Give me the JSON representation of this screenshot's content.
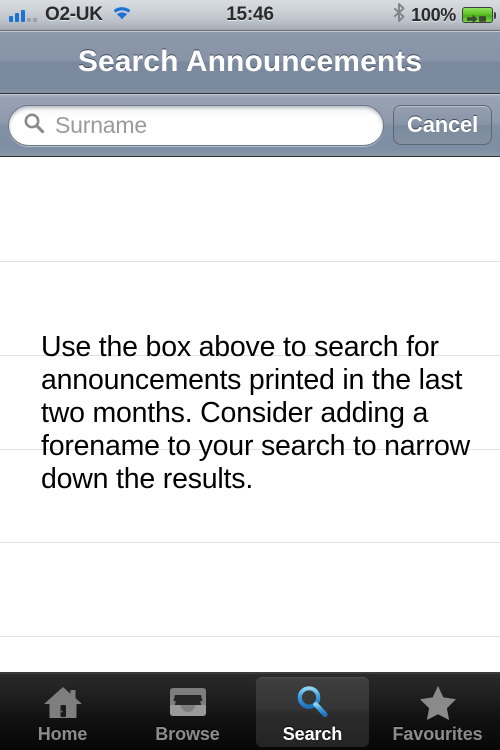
{
  "status_bar": {
    "signal_icon": "signal-bars-icon",
    "signal_bars_filled": 3,
    "signal_bars_empty": 2,
    "carrier": "O2-UK",
    "wifi_icon": "wifi-icon",
    "time": "15:46",
    "bluetooth_icon": "bluetooth-icon",
    "battery_percent": "100%",
    "battery_icon": "battery-charging-icon",
    "battery_color": "#5cc423"
  },
  "nav_bar": {
    "title": "Search Announcements"
  },
  "search_bar": {
    "search_icon": "search-icon",
    "placeholder": "Surname",
    "value": "",
    "cancel_label": "Cancel"
  },
  "content": {
    "info_text": "Use the box above to search for announcements printed in the last two months. Consider adding a forename to your search to narrow down the results.",
    "separator_color": "#e2e2e2",
    "separator_positions": [
      102,
      196,
      290,
      383,
      477
    ],
    "background": "#ffffff"
  },
  "tab_bar": {
    "active_tab": "Search",
    "active_color": "#3b9de0",
    "inactive_color": "#8c8c8c",
    "tabs": [
      {
        "label": "Home",
        "icon": "home-icon"
      },
      {
        "label": "Browse",
        "icon": "inbox-tray-icon"
      },
      {
        "label": "Search",
        "icon": "search-icon"
      },
      {
        "label": "Favourites",
        "icon": "star-icon"
      }
    ]
  }
}
